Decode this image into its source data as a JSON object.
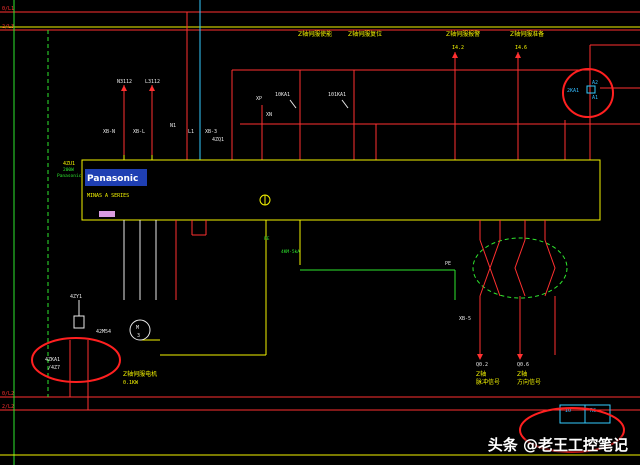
{
  "rails": {
    "top_left": "0/L1",
    "top_left2": "2/L3",
    "bottom_left": "0/L2",
    "bottom_left2": "2/L2"
  },
  "columns": [
    {
      "title": "Z轴伺服使能"
    },
    {
      "title": "Z轴伺服复位"
    },
    {
      "title": "Z轴伺服报警",
      "ref": "I4.2"
    },
    {
      "title": "Z轴伺服准备",
      "ref": "I4.6"
    }
  ],
  "driver": {
    "tag": "4ZU1",
    "sub1": "200W",
    "sub2": "Panasonic",
    "brand": "Panasonic",
    "series": "MINAS A SERIES"
  },
  "inputs": {
    "n3": "N3112",
    "l3": "L3112",
    "xb_n": "XB-N",
    "xb_l": "XB-L",
    "n1": "N1",
    "l1": "L1",
    "xb_3": "XB-3",
    "ka_a": "10KA1",
    "ka_b": "101KA1",
    "xp": "XP",
    "xn": "XN",
    "qf": "4ZQ1",
    "ka2": "2KA1",
    "a1": "A1",
    "a2": "A2"
  },
  "motor": {
    "tag": "42M54",
    "label": "M",
    "phase": "3",
    "name": "Z轴伺服电机",
    "power": "0.1KW"
  },
  "brake": {
    "tag": "4ZY1",
    "ka": "4ZKA1",
    "ka_ref": "/4Z7"
  },
  "pe": {
    "pe1": "PE",
    "pe1_sub": "4KM-5kA",
    "pe2": "PE",
    "xb": "XB-5"
  },
  "outputs": {
    "q2": "Q0.2",
    "q2_label": "Z轴",
    "q2_name": "脉冲信号",
    "q6": "Q0.6",
    "q6_label": "Z轴",
    "q6_name": "方向信号"
  },
  "bottom_box": {
    "a": "IO",
    "b": "RC"
  },
  "watermark": "头条 @老王工控笔记"
}
